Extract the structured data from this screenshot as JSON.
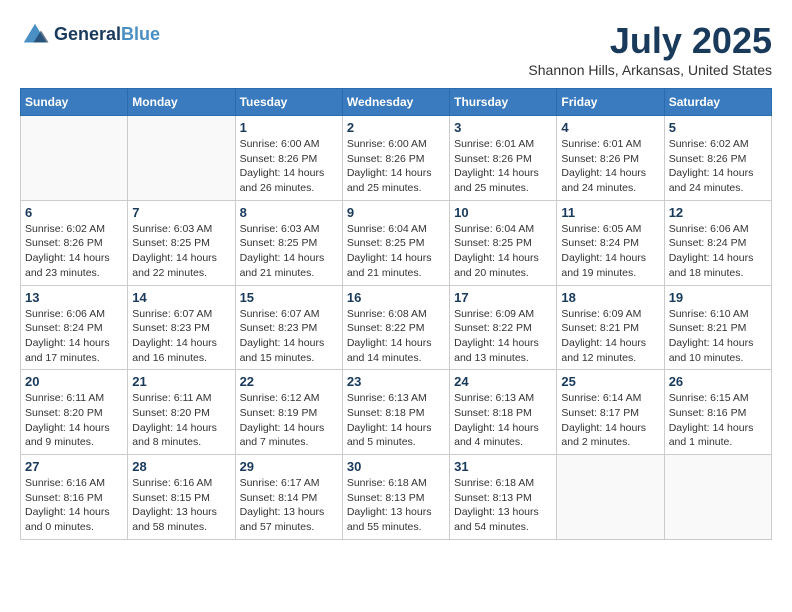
{
  "header": {
    "logo_line1": "General",
    "logo_line2": "Blue",
    "month": "July 2025",
    "location": "Shannon Hills, Arkansas, United States"
  },
  "weekdays": [
    "Sunday",
    "Monday",
    "Tuesday",
    "Wednesday",
    "Thursday",
    "Friday",
    "Saturday"
  ],
  "weeks": [
    [
      {
        "day": "",
        "info": ""
      },
      {
        "day": "",
        "info": ""
      },
      {
        "day": "1",
        "info": "Sunrise: 6:00 AM\nSunset: 8:26 PM\nDaylight: 14 hours and 26 minutes."
      },
      {
        "day": "2",
        "info": "Sunrise: 6:00 AM\nSunset: 8:26 PM\nDaylight: 14 hours and 25 minutes."
      },
      {
        "day": "3",
        "info": "Sunrise: 6:01 AM\nSunset: 8:26 PM\nDaylight: 14 hours and 25 minutes."
      },
      {
        "day": "4",
        "info": "Sunrise: 6:01 AM\nSunset: 8:26 PM\nDaylight: 14 hours and 24 minutes."
      },
      {
        "day": "5",
        "info": "Sunrise: 6:02 AM\nSunset: 8:26 PM\nDaylight: 14 hours and 24 minutes."
      }
    ],
    [
      {
        "day": "6",
        "info": "Sunrise: 6:02 AM\nSunset: 8:26 PM\nDaylight: 14 hours and 23 minutes."
      },
      {
        "day": "7",
        "info": "Sunrise: 6:03 AM\nSunset: 8:25 PM\nDaylight: 14 hours and 22 minutes."
      },
      {
        "day": "8",
        "info": "Sunrise: 6:03 AM\nSunset: 8:25 PM\nDaylight: 14 hours and 21 minutes."
      },
      {
        "day": "9",
        "info": "Sunrise: 6:04 AM\nSunset: 8:25 PM\nDaylight: 14 hours and 21 minutes."
      },
      {
        "day": "10",
        "info": "Sunrise: 6:04 AM\nSunset: 8:25 PM\nDaylight: 14 hours and 20 minutes."
      },
      {
        "day": "11",
        "info": "Sunrise: 6:05 AM\nSunset: 8:24 PM\nDaylight: 14 hours and 19 minutes."
      },
      {
        "day": "12",
        "info": "Sunrise: 6:06 AM\nSunset: 8:24 PM\nDaylight: 14 hours and 18 minutes."
      }
    ],
    [
      {
        "day": "13",
        "info": "Sunrise: 6:06 AM\nSunset: 8:24 PM\nDaylight: 14 hours and 17 minutes."
      },
      {
        "day": "14",
        "info": "Sunrise: 6:07 AM\nSunset: 8:23 PM\nDaylight: 14 hours and 16 minutes."
      },
      {
        "day": "15",
        "info": "Sunrise: 6:07 AM\nSunset: 8:23 PM\nDaylight: 14 hours and 15 minutes."
      },
      {
        "day": "16",
        "info": "Sunrise: 6:08 AM\nSunset: 8:22 PM\nDaylight: 14 hours and 14 minutes."
      },
      {
        "day": "17",
        "info": "Sunrise: 6:09 AM\nSunset: 8:22 PM\nDaylight: 14 hours and 13 minutes."
      },
      {
        "day": "18",
        "info": "Sunrise: 6:09 AM\nSunset: 8:21 PM\nDaylight: 14 hours and 12 minutes."
      },
      {
        "day": "19",
        "info": "Sunrise: 6:10 AM\nSunset: 8:21 PM\nDaylight: 14 hours and 10 minutes."
      }
    ],
    [
      {
        "day": "20",
        "info": "Sunrise: 6:11 AM\nSunset: 8:20 PM\nDaylight: 14 hours and 9 minutes."
      },
      {
        "day": "21",
        "info": "Sunrise: 6:11 AM\nSunset: 8:20 PM\nDaylight: 14 hours and 8 minutes."
      },
      {
        "day": "22",
        "info": "Sunrise: 6:12 AM\nSunset: 8:19 PM\nDaylight: 14 hours and 7 minutes."
      },
      {
        "day": "23",
        "info": "Sunrise: 6:13 AM\nSunset: 8:18 PM\nDaylight: 14 hours and 5 minutes."
      },
      {
        "day": "24",
        "info": "Sunrise: 6:13 AM\nSunset: 8:18 PM\nDaylight: 14 hours and 4 minutes."
      },
      {
        "day": "25",
        "info": "Sunrise: 6:14 AM\nSunset: 8:17 PM\nDaylight: 14 hours and 2 minutes."
      },
      {
        "day": "26",
        "info": "Sunrise: 6:15 AM\nSunset: 8:16 PM\nDaylight: 14 hours and 1 minute."
      }
    ],
    [
      {
        "day": "27",
        "info": "Sunrise: 6:16 AM\nSunset: 8:16 PM\nDaylight: 14 hours and 0 minutes."
      },
      {
        "day": "28",
        "info": "Sunrise: 6:16 AM\nSunset: 8:15 PM\nDaylight: 13 hours and 58 minutes."
      },
      {
        "day": "29",
        "info": "Sunrise: 6:17 AM\nSunset: 8:14 PM\nDaylight: 13 hours and 57 minutes."
      },
      {
        "day": "30",
        "info": "Sunrise: 6:18 AM\nSunset: 8:13 PM\nDaylight: 13 hours and 55 minutes."
      },
      {
        "day": "31",
        "info": "Sunrise: 6:18 AM\nSunset: 8:13 PM\nDaylight: 13 hours and 54 minutes."
      },
      {
        "day": "",
        "info": ""
      },
      {
        "day": "",
        "info": ""
      }
    ]
  ]
}
